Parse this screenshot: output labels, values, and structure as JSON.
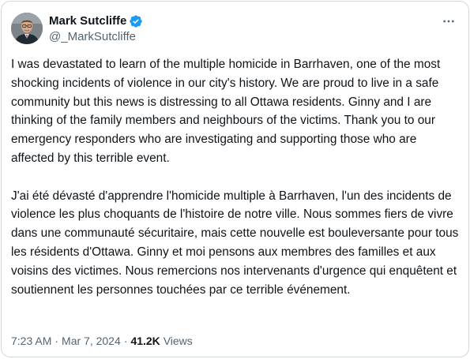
{
  "author": {
    "display_name": "Mark Sutcliffe",
    "handle": "@_MarkSutcliffe",
    "verified": true,
    "verified_color": "#1d9bf0",
    "avatar_icon": "profile-photo"
  },
  "menu": {
    "icon": "more-horizontal-icon"
  },
  "tweet": {
    "paragraphs": [
      "I was devastated to learn of the multiple homicide in Barrhaven, one of the most shocking incidents of violence in our city's history. We are proud to live in a safe community but this news is distressing to all Ottawa residents. Ginny and I are thinking of the family members and neighbours of the victims. Thank you to our emergency responders who are investigating and supporting those who are affected by this terrible event.",
      "J'ai été dévasté d'apprendre l'homicide multiple à Barrhaven, l'un des incidents de violence les plus choquants de l'histoire de notre ville. Nous sommes fiers de vivre dans une communauté sécuritaire, mais cette nouvelle est bouleversante pour tous les résidents d'Ottawa. Ginny et moi pensons aux membres des familles et aux voisins des victimes. Nous remercions nos intervenants d'urgence qui enquêtent et soutiennent les personnes touchées par ce terrible événement."
    ]
  },
  "meta": {
    "time": "7:23 AM",
    "separator": "·",
    "date": "Mar 7, 2024",
    "views_count": "41.2K",
    "views_label": "Views"
  },
  "colors": {
    "text_primary": "#0f1419",
    "text_secondary": "#536471",
    "border": "#cfd9de"
  }
}
